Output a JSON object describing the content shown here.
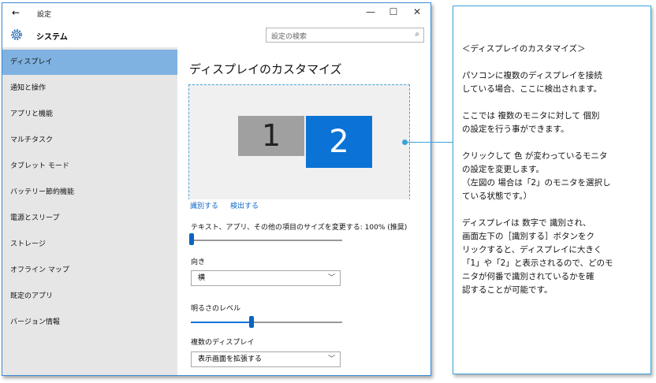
{
  "window": {
    "back_glyph": "←",
    "title": "設定",
    "minimize_glyph": "—",
    "maximize_glyph": "☐",
    "close_glyph": "✕"
  },
  "header": {
    "section_title": "システム",
    "search_placeholder": "設定の検索",
    "search_icon": "search-icon",
    "gear_icon": "gear-icon"
  },
  "sidebar": {
    "items": [
      {
        "label": "ディスプレイ",
        "active": true
      },
      {
        "label": "通知と操作"
      },
      {
        "label": "アプリと機能"
      },
      {
        "label": "マルチタスク"
      },
      {
        "label": "タブレット モード"
      },
      {
        "label": "バッテリー節約機能"
      },
      {
        "label": "電源とスリープ"
      },
      {
        "label": "ストレージ"
      },
      {
        "label": "オフライン マップ"
      },
      {
        "label": "既定のアプリ"
      },
      {
        "label": "バージョン情報"
      }
    ]
  },
  "main": {
    "heading": "ディスプレイのカスタマイズ",
    "monitor1": "1",
    "monitor2": "2",
    "identify_link": "識別する",
    "detect_link": "検出する",
    "scale_label": "テキスト、アプリ、その他の項目のサイズを変更する: 100% (推奨)",
    "scale_value": 0.0,
    "orientation_label": "向き",
    "orientation_value": "横",
    "brightness_label": "明るさのレベル",
    "brightness_value": 0.4,
    "multi_display_label": "複数のディスプレイ",
    "multi_display_value": "表示画面を拡張する"
  },
  "annotation": {
    "lines": [
      "＜ディスプレイのカスタマイズ＞",
      "",
      "パソコンに複数のディスプレイを接続",
      "している場合、ここに検出されます。",
      "",
      "ここでは 複数のモニタに対して 個別",
      "の設定を行う事ができます。",
      "",
      "クリックして 色 が変わっているモニタ",
      "の設定を変更します。",
      "（左図の 場合は「2」のモニタを選択し",
      "ている状態です。）",
      "",
      "ディスプレイは 数字で 識別され、",
      "画面左下の［識別する］ボタンをク",
      "リックすると、ディスプレイに大きく",
      "「1」や「2」と表示されるので、どのモ",
      "ニタが何番で識別されているかを確",
      "認することが可能です。"
    ]
  },
  "colors": {
    "accent": "#0c73d6",
    "sidebar_active": "#7fb2e1",
    "sidebar_bg": "#e6e6e6",
    "annotation_border": "#3aa3d8"
  }
}
